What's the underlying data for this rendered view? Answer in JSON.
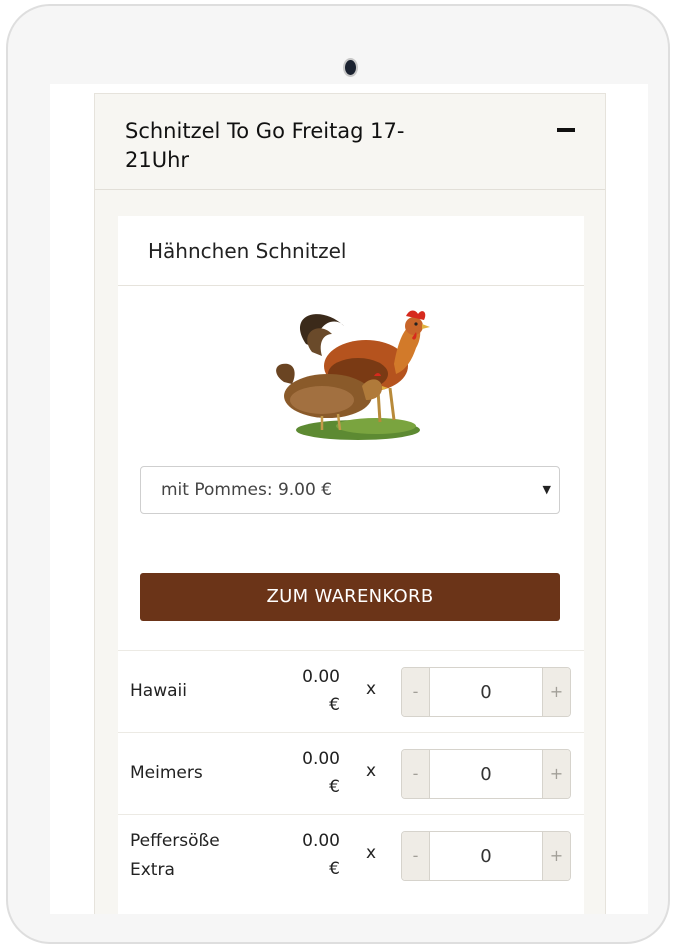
{
  "section": {
    "title": "Schnitzel To Go Freitag 17-21Uhr"
  },
  "product": {
    "title": "Hähnchen Schnitzel",
    "image_alt": "rooster and hen",
    "option_selected": "mit Pommes: 9.00 €",
    "cart_button": "ZUM WARENKORB"
  },
  "extras": [
    {
      "name": "Hawaii",
      "price": "0.00 €",
      "multiplier": "x",
      "quantity": "0"
    },
    {
      "name": "Meimers",
      "price": "0.00 €",
      "multiplier": "x",
      "quantity": "0"
    },
    {
      "name": "Peffersöße Extra",
      "price": "0.00 €",
      "multiplier": "x",
      "quantity": "0"
    }
  ],
  "stepper": {
    "minus": "-",
    "plus": "+"
  },
  "icons": {
    "collapse": "minus-icon",
    "dropdown": "caret-down-icon"
  },
  "colors": {
    "accent": "#6b3418",
    "panel_bg": "#f7f6f2"
  }
}
